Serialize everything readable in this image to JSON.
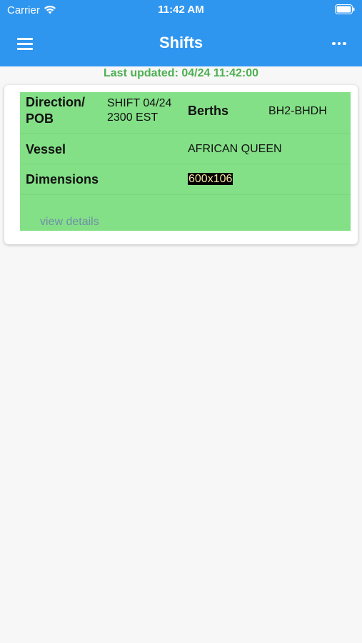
{
  "status_bar": {
    "carrier": "Carrier",
    "time": "11:42 AM"
  },
  "navbar": {
    "title": "Shifts"
  },
  "last_updated": "Last updated: 04/24 11:42:00",
  "shift_card": {
    "direction_label_line1": "Direction/",
    "direction_label_line2": "POB",
    "direction_value_line1": "SHIFT 04/24",
    "direction_value_line2": "2300 EST",
    "berths_label": "Berths",
    "berths_value": "BH2-BHDH",
    "vessel_label": "Vessel",
    "vessel_value": "AFRICAN QUEEN",
    "dimensions_label": "Dimensions",
    "dimensions_value": "600x106",
    "view_details": "view details"
  },
  "colors": {
    "header": "#2f96ef",
    "card_background": "#84e087",
    "last_updated_text": "#4caf50"
  }
}
